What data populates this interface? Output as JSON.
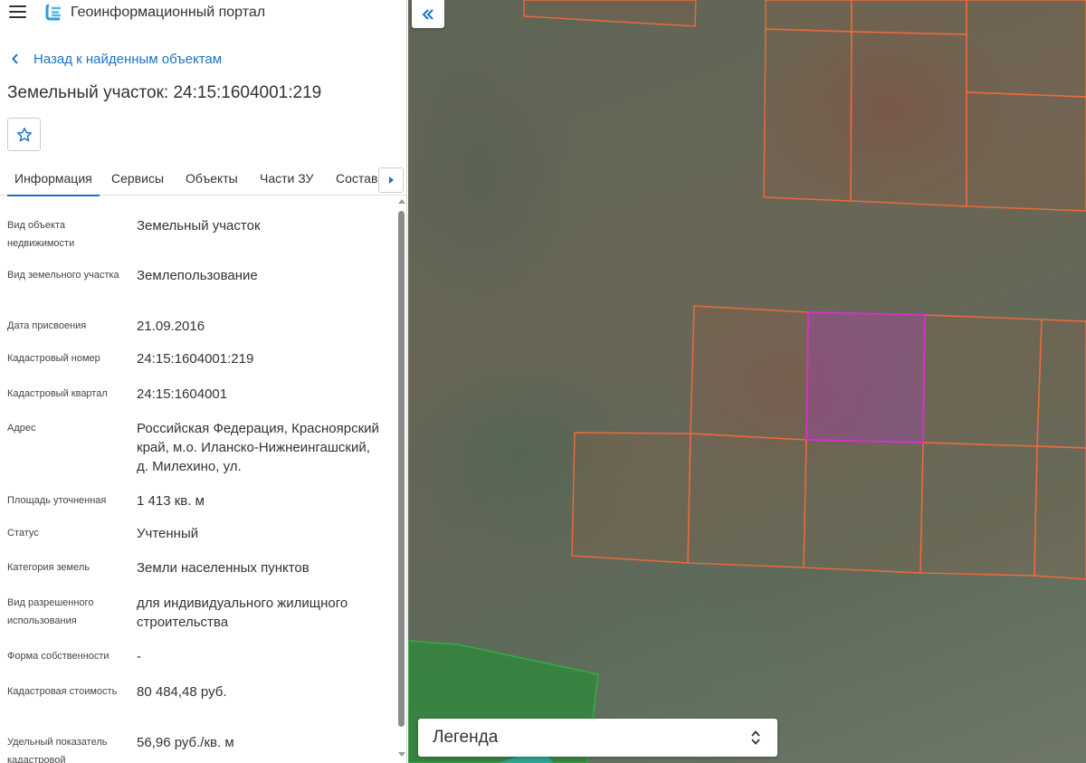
{
  "app": {
    "title": "Геоинформационный портал"
  },
  "nav": {
    "back_label": "Назад к найденным объектам"
  },
  "object": {
    "title": "Земельный участок: 24:15:1604001:219"
  },
  "tabs": [
    {
      "label": "Информация",
      "active": true
    },
    {
      "label": "Сервисы",
      "active": false
    },
    {
      "label": "Объекты",
      "active": false
    },
    {
      "label": "Части ЗУ",
      "active": false
    },
    {
      "label": "Состав",
      "active": false
    }
  ],
  "info": [
    {
      "label": "Вид объекта недвижимости",
      "value": "Земельный участок"
    },
    {
      "label": "Вид земельного участка",
      "value": "Землепользование"
    },
    {
      "label": "Дата присвоения",
      "value": "21.09.2016"
    },
    {
      "label": "Кадастровый номер",
      "value": "24:15:1604001:219"
    },
    {
      "label": "Кадастровый квартал",
      "value": "24:15:1604001"
    },
    {
      "label": "Адрес",
      "value": "Российская Федерация, Красноярский край, м.о. Иланско-Нижнеингашский, д. Милехино, ул."
    },
    {
      "label": "Площадь уточненная",
      "value": "1 413 кв. м"
    },
    {
      "label": "Статус",
      "value": "Учтенный"
    },
    {
      "label": "Категория земель",
      "value": "Земли населенных пунктов"
    },
    {
      "label": "Вид разрешенного использования",
      "value": "для индивидуального жилищного строительства"
    },
    {
      "label": "Форма собственности",
      "value": "-"
    },
    {
      "label": "Кадастровая стоимость",
      "value": "80 484,48 руб."
    },
    {
      "label": "Удельный показатель кадастровой",
      "value": "56,96 руб./кв. м"
    }
  ],
  "map": {
    "legend_label": "Легенда",
    "parcel_color": "#f06a3a",
    "selected_parcel_color": "#d233c8",
    "green_zone_color": "#2e8a3a"
  },
  "colors": {
    "accent": "#1a73c8"
  },
  "icons": {
    "menu": "hamburger-icon",
    "logo": "portal-logo-icon",
    "back": "chevron-left-icon",
    "favorite": "star-icon",
    "tabs_next": "caret-right-icon",
    "collapse": "double-chevron-left-icon",
    "legend_toggle": "up-down-arrows-icon"
  }
}
